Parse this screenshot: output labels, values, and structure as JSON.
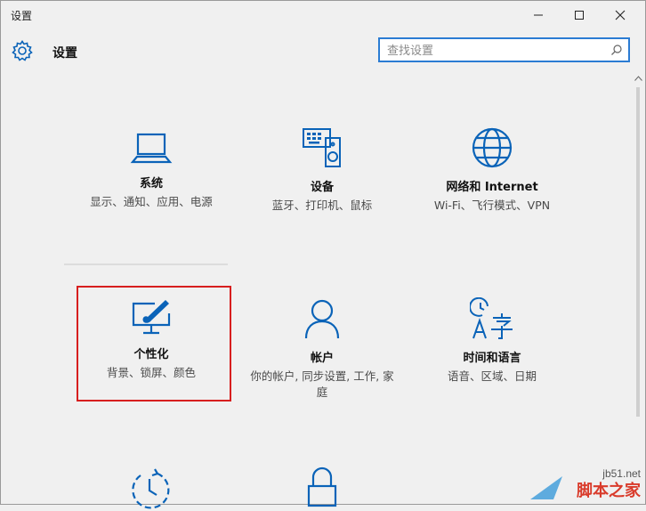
{
  "window": {
    "title": "设置"
  },
  "header": {
    "title": "设置"
  },
  "search": {
    "placeholder": "查找设置"
  },
  "tiles": [
    {
      "title": "系统",
      "description": "显示、通知、应用、电源",
      "icon": "laptop-icon"
    },
    {
      "title": "设备",
      "description": "蓝牙、打印机、鼠标",
      "icon": "devices-icon"
    },
    {
      "title": "网络和 Internet",
      "description": "Wi-Fi、飞行模式、VPN",
      "icon": "globe-icon"
    },
    {
      "title": "个性化",
      "description": "背景、锁屏、颜色",
      "icon": "personalization-icon"
    },
    {
      "title": "帐户",
      "description": "你的帐户, 同步设置, 工作, 家庭",
      "icon": "person-icon"
    },
    {
      "title": "时间和语言",
      "description": "语音、区域、日期",
      "icon": "time-language-icon"
    },
    {
      "title": "",
      "description": "",
      "icon": "clock-arrow-icon"
    },
    {
      "title": "",
      "description": "",
      "icon": "lock-icon"
    }
  ],
  "watermark": {
    "url": "jb51.net",
    "name": "脚本之家"
  },
  "colors": {
    "accent": "#0a63b8",
    "highlight": "#d71e1e",
    "background": "#f0f0f0"
  }
}
